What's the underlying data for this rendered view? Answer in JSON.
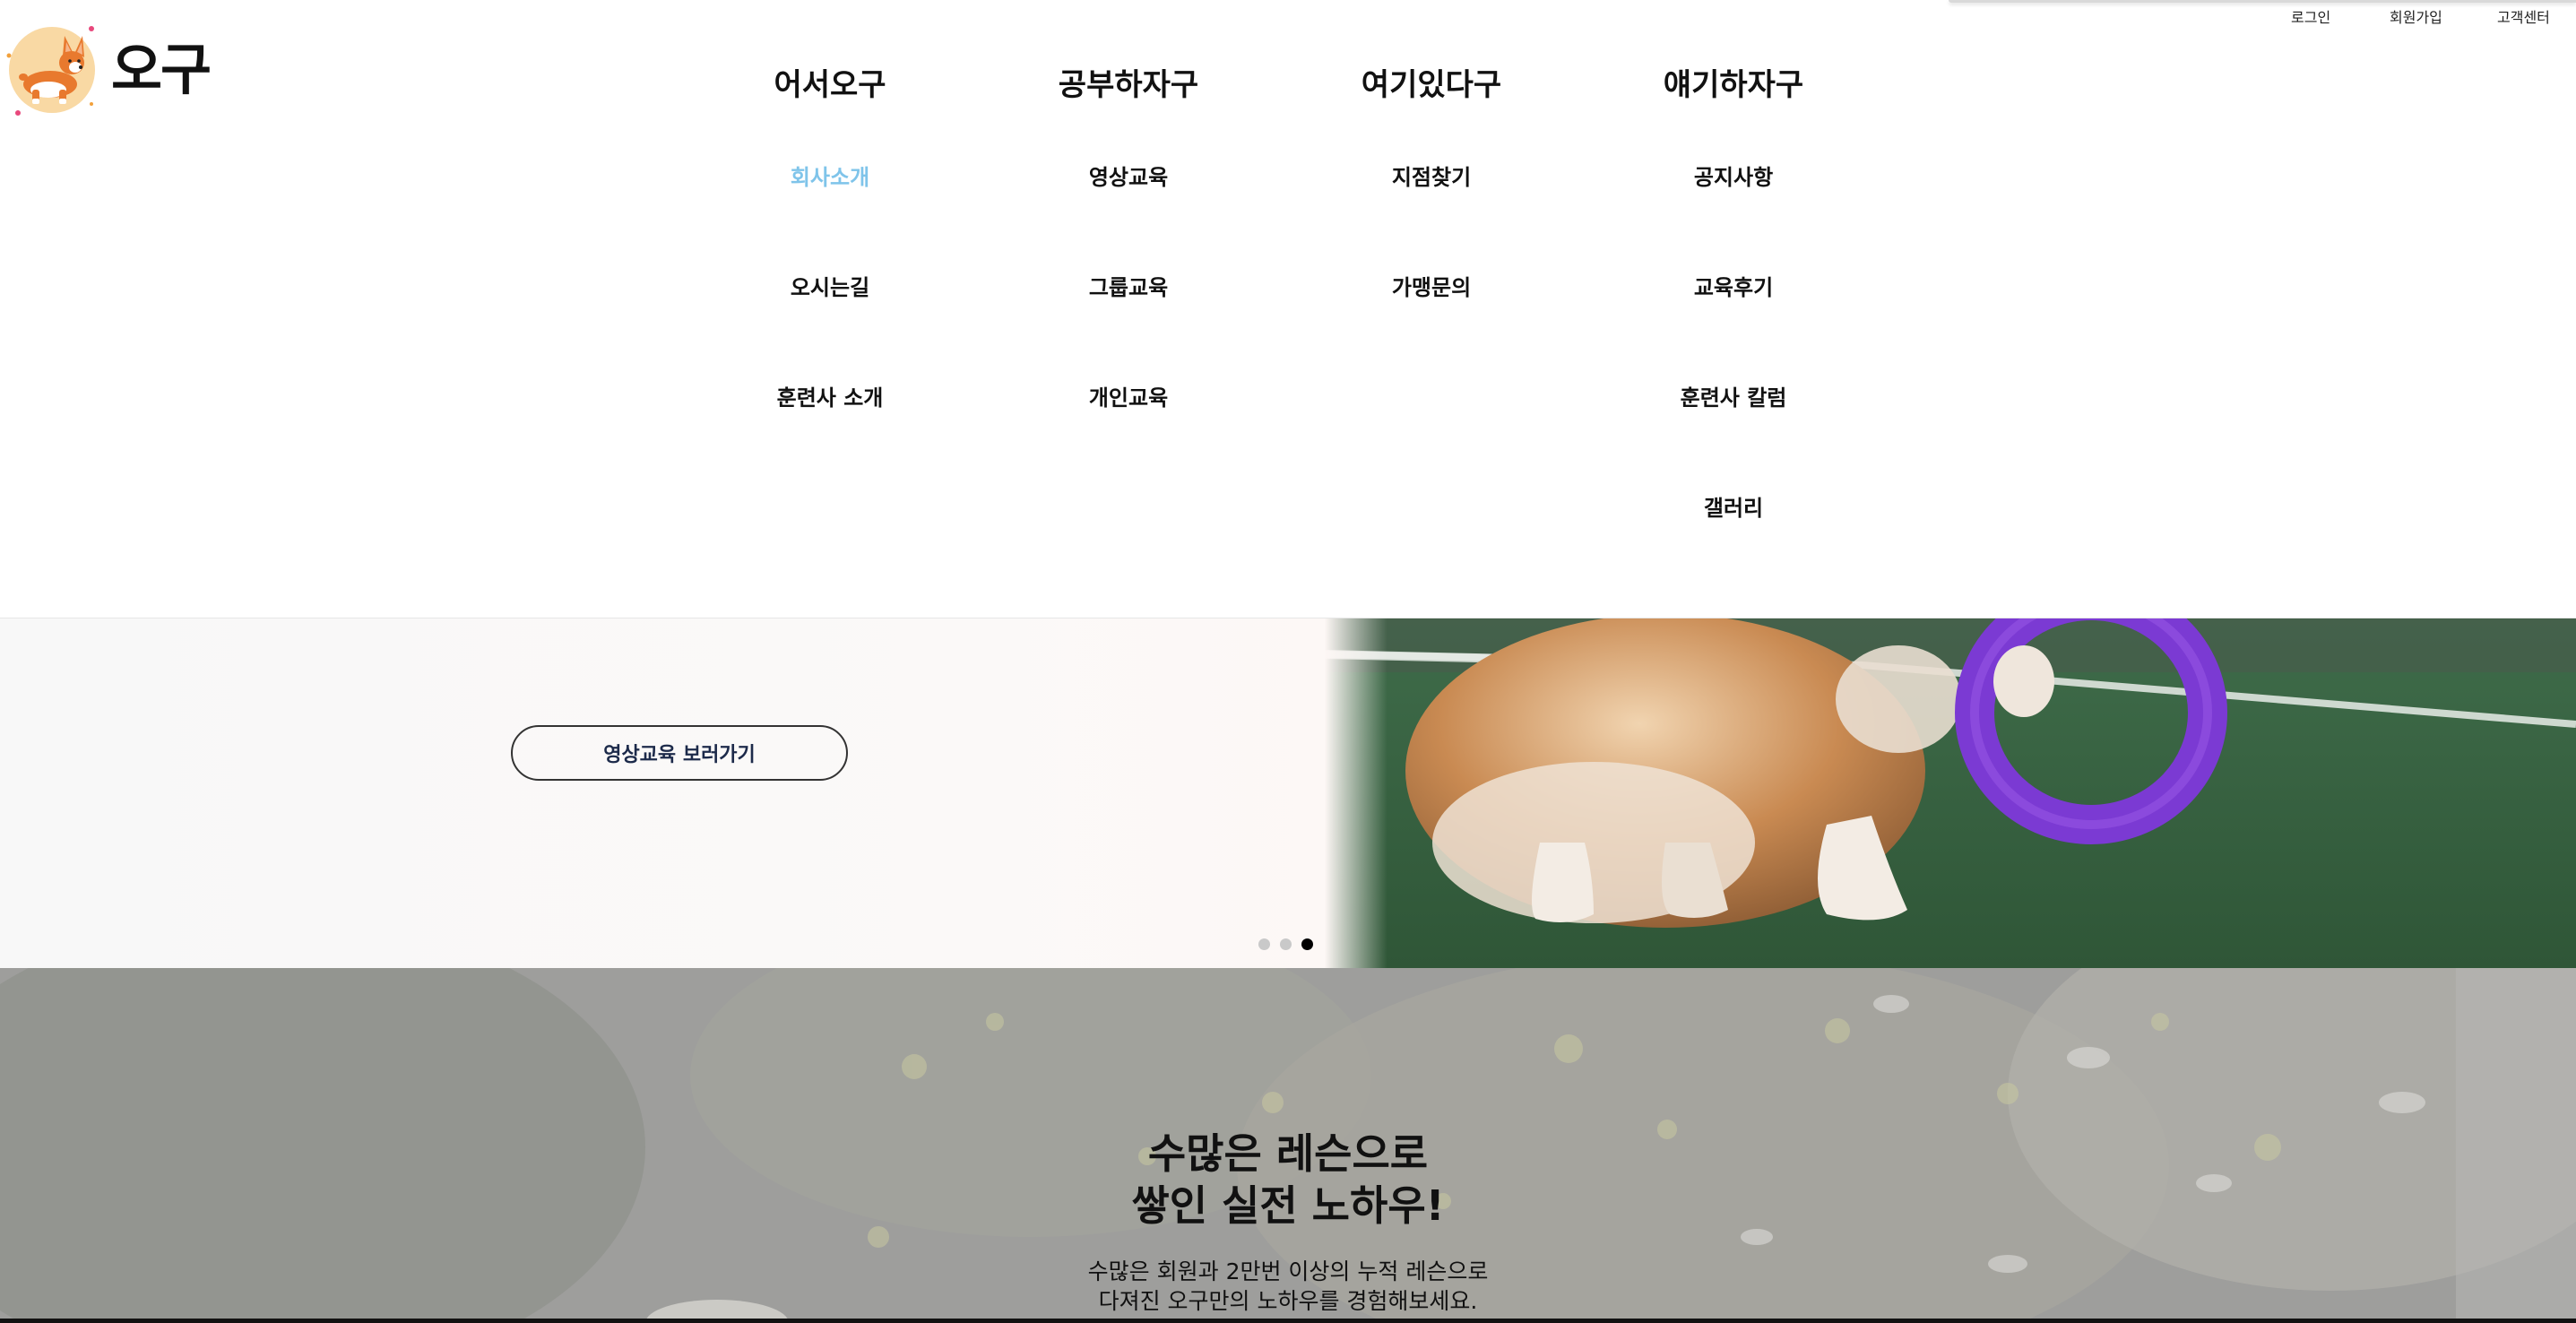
{
  "utility_nav": {
    "login": "로그인",
    "signup": "회원가입",
    "support": "고객센터"
  },
  "logo": {
    "text": "오구",
    "icon": "corgi-icon"
  },
  "menu": [
    {
      "title": "어서오구",
      "items": [
        {
          "label": "회사소개",
          "active": true
        },
        {
          "label": "오시는길"
        },
        {
          "label": "훈련사 소개"
        }
      ]
    },
    {
      "title": "공부하자구",
      "items": [
        {
          "label": "영상교육"
        },
        {
          "label": "그룹교육"
        },
        {
          "label": "개인교육"
        }
      ]
    },
    {
      "title": "여기있다구",
      "items": [
        {
          "label": "지점찾기"
        },
        {
          "label": "가맹문의"
        }
      ]
    },
    {
      "title": "얘기하자구",
      "items": [
        {
          "label": "공지사항"
        },
        {
          "label": "교육후기"
        },
        {
          "label": "훈련사 칼럼"
        },
        {
          "label": "갤러리"
        }
      ]
    }
  ],
  "hero": {
    "button_label": "영상교육 보러가기",
    "slide_count": 3,
    "active_slide": 3
  },
  "lesson": {
    "title_line1": "수많은 레슨으로",
    "title_line2": "쌓인 실전 노하우!",
    "desc_line1": "수많은 회원과 2만번 이상의 누적 레슨으로",
    "desc_line2": "다져진 오구만의 노하우를 경험해보세요."
  },
  "colors": {
    "active_menu": "#7fc4ea",
    "accent_ring": "#7b3ad3",
    "logo_circle": "#f9d9a4"
  }
}
